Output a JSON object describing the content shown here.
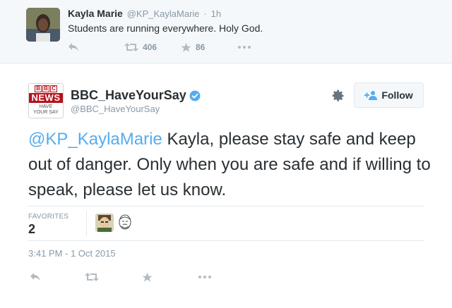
{
  "parent_tweet": {
    "name": "Kayla Marie",
    "handle": "@KP_KaylaMarie",
    "separator": "·",
    "time": "1h",
    "text": "Students are running everywhere. Holy God.",
    "retweet_count": "406",
    "favorite_count": "86"
  },
  "main_tweet": {
    "name": "BBC_HaveYourSay",
    "handle": "@BBC_HaveYourSay",
    "logo_text": [
      "B",
      "B",
      "C",
      "NEWS",
      "HAVE",
      "YOUR SAY"
    ],
    "follow_label": "Follow",
    "mention": "@KP_KaylaMarie",
    "body": " Kayla, please stay safe and keep out of danger. Only when you are safe and if willing to speak, please let us know.",
    "favorites_label": "FAVORITES",
    "favorites_count": "2",
    "date": "3:41 PM - 1 Oct 2015"
  },
  "icons": {
    "reply": "reply-icon",
    "retweet": "retweet-icon",
    "favorite": "star-icon",
    "more": "more-icon",
    "settings": "gear-icon",
    "verified": "verified-badge-icon",
    "follow": "add-user-icon"
  },
  "colors": {
    "link": "#55acee",
    "muted": "#8899a6",
    "text": "#292f33",
    "bbc_red": "#b5121b",
    "parent_bg": "#f5f8fa"
  }
}
